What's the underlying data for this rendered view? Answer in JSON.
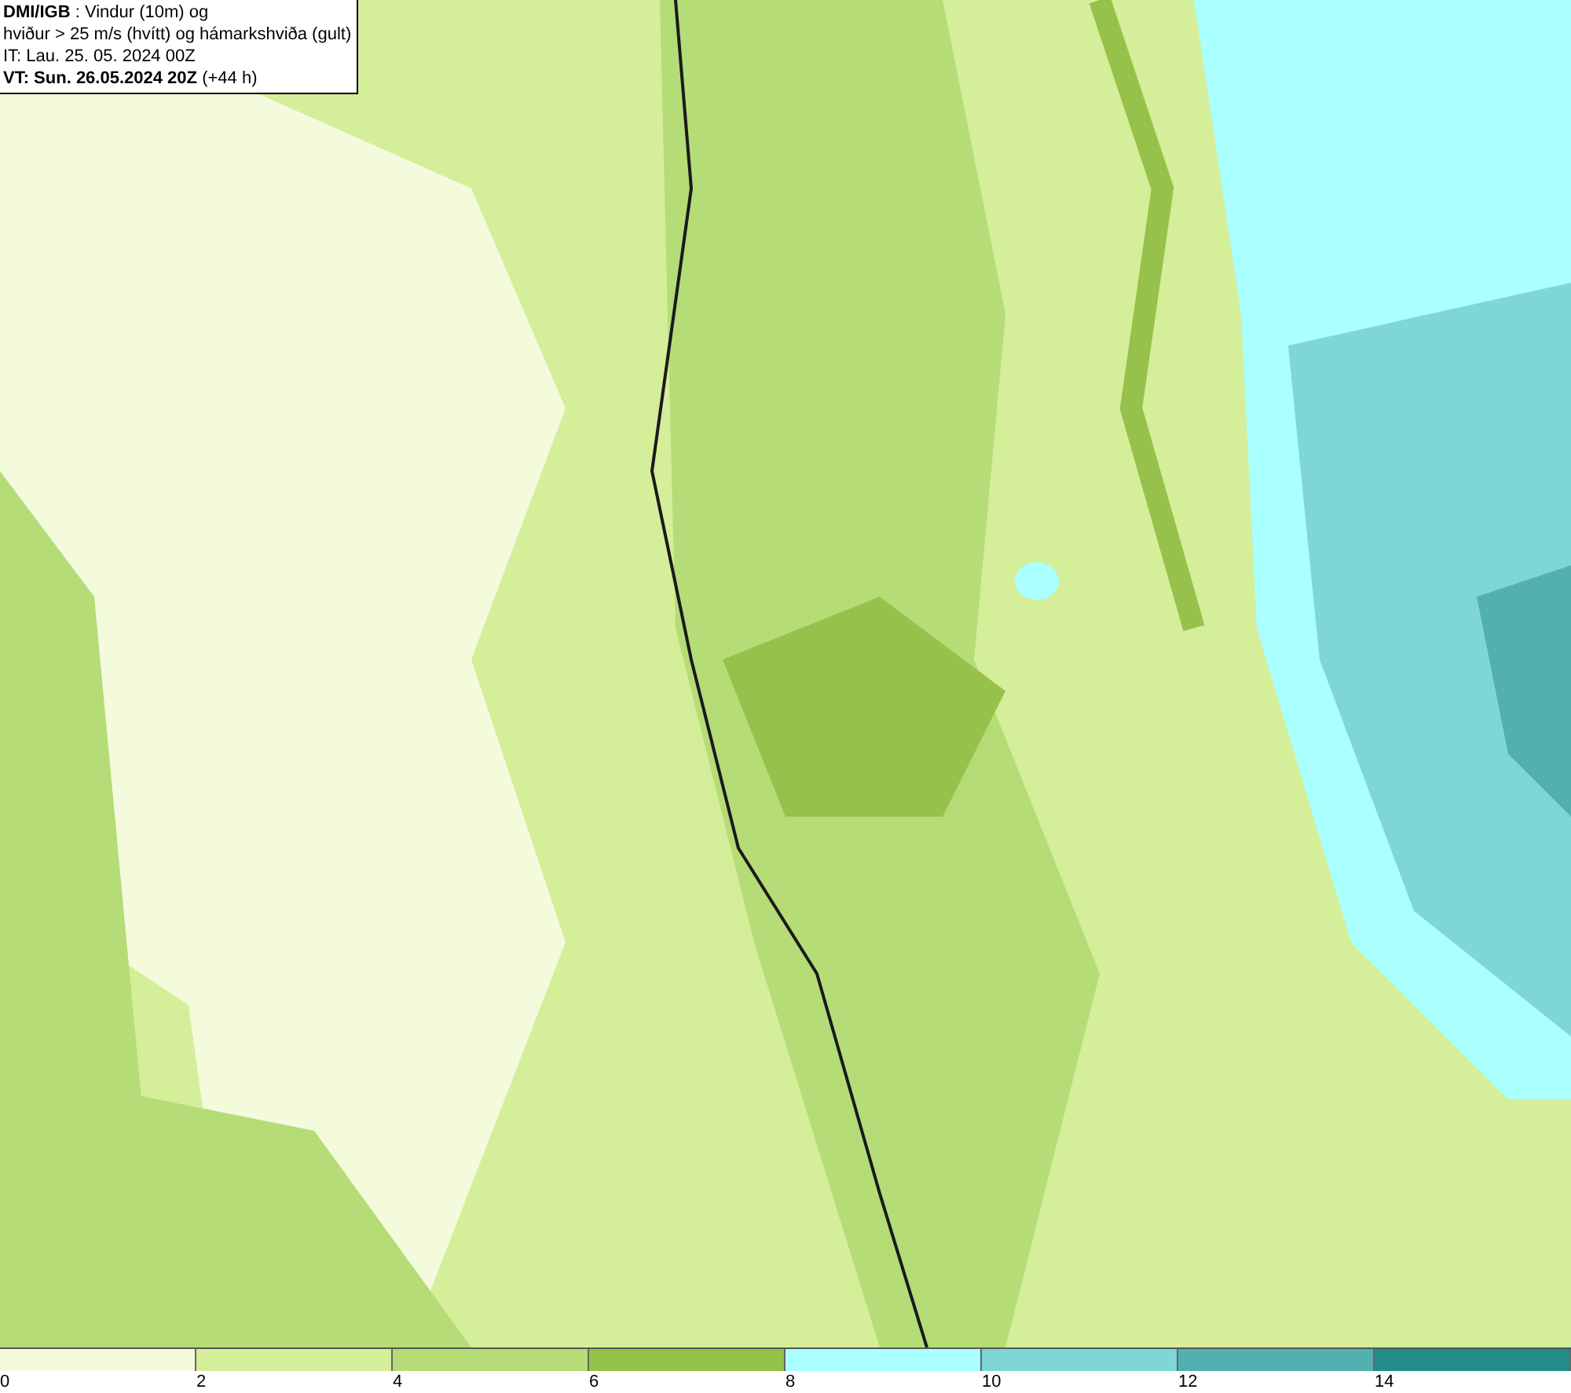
{
  "title_box": {
    "lines": [
      "**DMI/IGB** : Vindur (10m) og",
      "hviður > 25 m/s (hvítt) og hámarkshviða (gult)",
      "IT: Lau. 25. 05. 2024 00Z",
      "**VT: Sun. 26.05.2024 20Z** (+44 h)"
    ]
  },
  "legend": {
    "bins": [
      {
        "label": "0",
        "color": "#f4fbdc"
      },
      {
        "label": "2",
        "color": "#d4ee9a"
      },
      {
        "label": "4",
        "color": "#b5dc76"
      },
      {
        "label": "6",
        "color": "#96c14a"
      },
      {
        "label": "8",
        "color": "#aaffff"
      },
      {
        "label": "10",
        "color": "#7fd6d6"
      },
      {
        "label": "12",
        "color": "#52b0b0"
      },
      {
        "label": "14",
        "color": "#258c8c"
      }
    ]
  }
}
